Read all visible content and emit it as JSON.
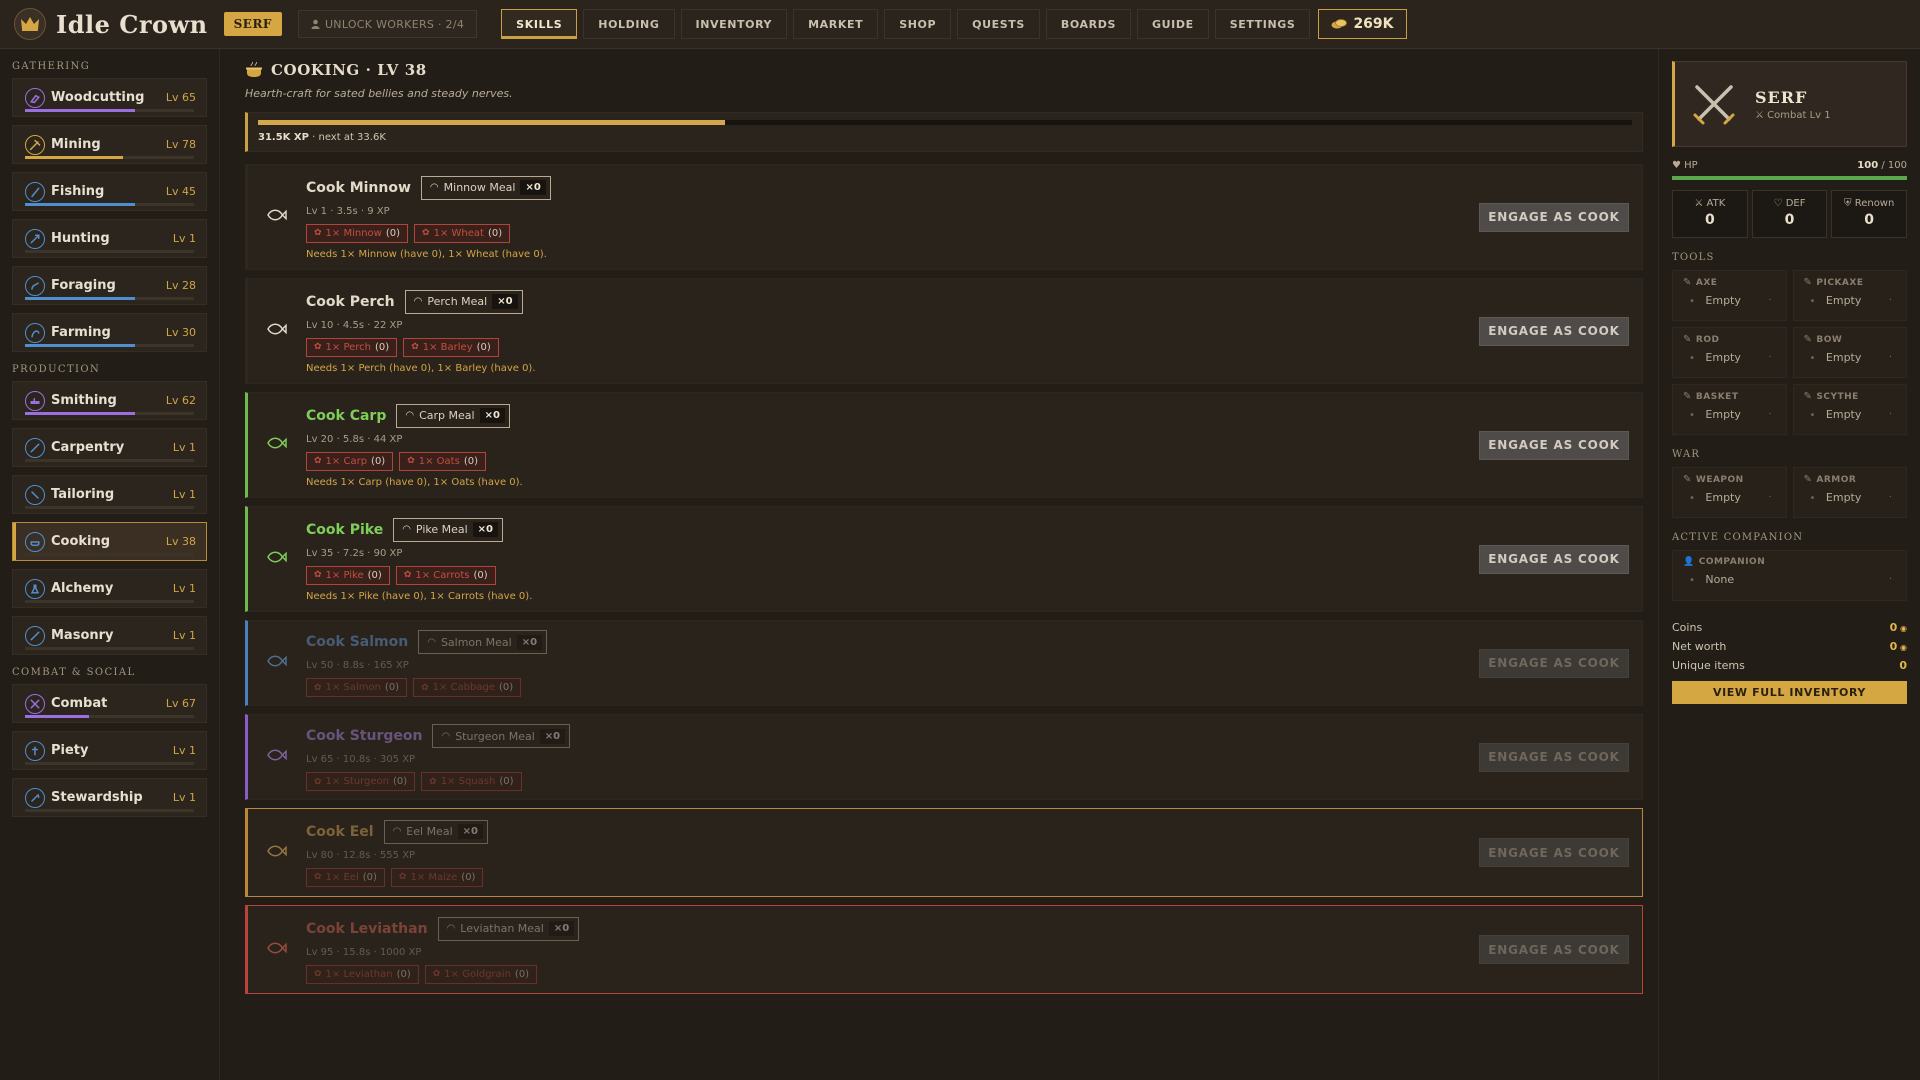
{
  "app": {
    "title": "Idle Crown",
    "rank": "SERF",
    "unlock_workers": "UNLOCK WORKERS · 2/4",
    "coins": "269K"
  },
  "nav": [
    "SKILLS",
    "HOLDING",
    "INVENTORY",
    "MARKET",
    "SHOP",
    "QUESTS",
    "BOARDS",
    "GUIDE",
    "SETTINGS"
  ],
  "sidebar": {
    "groups": [
      {
        "title": "GATHERING",
        "items": [
          {
            "label": "Woodcutting",
            "level": "Lv 65",
            "progress": 0.65,
            "color": "#9b6fe0"
          },
          {
            "label": "Mining",
            "level": "Lv 78",
            "progress": 0.58,
            "color": "#d4a743"
          },
          {
            "label": "Fishing",
            "level": "Lv 45",
            "progress": 0.65,
            "color": "#4f8fd0"
          },
          {
            "label": "Hunting",
            "level": "Lv 1",
            "progress": 0.0,
            "color": "#4f8fd0"
          },
          {
            "label": "Foraging",
            "level": "Lv 28",
            "progress": 0.65,
            "color": "#4f8fd0"
          },
          {
            "label": "Farming",
            "level": "Lv 30",
            "progress": 0.65,
            "color": "#4f8fd0"
          }
        ]
      },
      {
        "title": "PRODUCTION",
        "items": [
          {
            "label": "Smithing",
            "level": "Lv 62",
            "progress": 0.65,
            "color": "#9b6fe0"
          },
          {
            "label": "Carpentry",
            "level": "Lv 1",
            "progress": 0.0,
            "color": "#4f8fd0"
          },
          {
            "label": "Tailoring",
            "level": "Lv 1",
            "progress": 0.0,
            "color": "#4f8fd0"
          },
          {
            "label": "Cooking",
            "level": "Lv 38",
            "progress": 0.0,
            "color": "#4f8fd0"
          },
          {
            "label": "Alchemy",
            "level": "Lv 1",
            "progress": 0.0,
            "color": "#4f8fd0"
          },
          {
            "label": "Masonry",
            "level": "Lv 1",
            "progress": 0.0,
            "color": "#4f8fd0"
          }
        ]
      },
      {
        "title": "COMBAT & SOCIAL",
        "items": [
          {
            "label": "Combat",
            "level": "Lv 67",
            "progress": 0.38,
            "color": "#9b6fe0"
          },
          {
            "label": "Piety",
            "level": "Lv 1",
            "progress": 0.0,
            "color": "#4f8fd0"
          },
          {
            "label": "Stewardship",
            "level": "Lv 1",
            "progress": 0.0,
            "color": "#4f8fd0"
          }
        ]
      }
    ]
  },
  "main": {
    "title": "COOKING · LV 38",
    "subtitle": "Hearth-craft for sated bellies and steady nerves.",
    "xp_current": "31.5K XP",
    "xp_next": " · next at 33.6K",
    "xp_progress": 0.34,
    "engage_label": "ENGAGE AS COOK",
    "recipes": [
      {
        "name": "Cook Minnow",
        "product": "Minnow Meal",
        "count": "×0",
        "meta": "Lv 1 · 3.5s · 9 XP",
        "chips": [
          {
            "label": "1× Minnow",
            "have": "(0)"
          },
          {
            "label": "1× Wheat",
            "have": "(0)"
          }
        ],
        "need": "Needs 1× Minnow (have 0), 1× Wheat (have 0).",
        "accent": "#2e271f",
        "title_color": "#e3d9c8",
        "locked": false
      },
      {
        "name": "Cook Perch",
        "product": "Perch Meal",
        "count": "×0",
        "meta": "Lv 10 · 4.5s · 22 XP",
        "chips": [
          {
            "label": "1× Perch",
            "have": "(0)"
          },
          {
            "label": "1× Barley",
            "have": "(0)"
          }
        ],
        "need": "Needs 1× Perch (have 0), 1× Barley (have 0).",
        "accent": "#2e271f",
        "title_color": "#e3d9c8",
        "locked": false
      },
      {
        "name": "Cook Carp",
        "product": "Carp Meal",
        "count": "×0",
        "meta": "Lv 20 · 5.8s · 44 XP",
        "chips": [
          {
            "label": "1× Carp",
            "have": "(0)"
          },
          {
            "label": "1× Oats",
            "have": "(0)"
          }
        ],
        "need": "Needs 1× Carp (have 0), 1× Oats (have 0).",
        "accent": "#6dbb4c",
        "title_color": "#7fce5a",
        "locked": false
      },
      {
        "name": "Cook Pike",
        "product": "Pike Meal",
        "count": "×0",
        "meta": "Lv 35 · 7.2s · 90 XP",
        "chips": [
          {
            "label": "1× Pike",
            "have": "(0)"
          },
          {
            "label": "1× Carrots",
            "have": "(0)"
          }
        ],
        "need": "Needs 1× Pike (have 0), 1× Carrots (have 0).",
        "accent": "#6dbb4c",
        "title_color": "#7fce5a",
        "locked": false
      },
      {
        "name": "Cook Salmon",
        "product": "Salmon Meal",
        "count": "×0",
        "meta": "Lv 50 · 8.8s · 165 XP",
        "chips": [
          {
            "label": "1× Salmon",
            "have": "(0)"
          },
          {
            "label": "1× Cabbage",
            "have": "(0)"
          }
        ],
        "need": "",
        "accent": "#4a7fc0",
        "title_color": "#6c9fe0",
        "locked": true
      },
      {
        "name": "Cook Sturgeon",
        "product": "Sturgeon Meal",
        "count": "×0",
        "meta": "Lv 65 · 10.8s · 305 XP",
        "chips": [
          {
            "label": "1× Sturgeon",
            "have": "(0)"
          },
          {
            "label": "1× Squash",
            "have": "(0)"
          }
        ],
        "need": "",
        "accent": "#8a5cc8",
        "title_color": "#b58ef0",
        "locked": true
      },
      {
        "name": "Cook Eel",
        "product": "Eel Meal",
        "count": "×0",
        "meta": "Lv 80 · 12.8s · 555 XP",
        "chips": [
          {
            "label": "1× Eel",
            "have": "(0)"
          },
          {
            "label": "1× Maize",
            "have": "(0)"
          }
        ],
        "need": "",
        "accent": "#b8893a",
        "title_color": "#e0b05a",
        "locked": true
      },
      {
        "name": "Cook Leviathan",
        "product": "Leviathan Meal",
        "count": "×0",
        "meta": "Lv 95 · 15.8s · 1000 XP",
        "chips": [
          {
            "label": "1× Leviathan",
            "have": "(0)"
          },
          {
            "label": "1× Goldgrain",
            "have": "(0)"
          }
        ],
        "need": "",
        "accent": "#b8433a",
        "title_color": "#e06a55",
        "locked": true
      }
    ]
  },
  "right": {
    "name": "SERF",
    "combat": "Combat Lv 1",
    "hp_label": "HP",
    "hp_value": "100",
    "hp_max": " / 100",
    "hp_progress": 1.0,
    "stats": [
      {
        "label": "ATK",
        "value": "0"
      },
      {
        "label": "DEF",
        "value": "0"
      },
      {
        "label": "Renown",
        "value": "0"
      }
    ],
    "tools_title": "TOOLS",
    "tools": [
      {
        "label": "AXE",
        "value": "Empty"
      },
      {
        "label": "PICKAXE",
        "value": "Empty"
      },
      {
        "label": "ROD",
        "value": "Empty"
      },
      {
        "label": "BOW",
        "value": "Empty"
      },
      {
        "label": "BASKET",
        "value": "Empty"
      },
      {
        "label": "SCYTHE",
        "value": "Empty"
      }
    ],
    "war_title": "WAR",
    "war": [
      {
        "label": "WEAPON",
        "value": "Empty"
      },
      {
        "label": "ARMOR",
        "value": "Empty"
      }
    ],
    "companion_title": "ACTIVE COMPANION",
    "companion": {
      "label": "COMPANION",
      "value": "None"
    },
    "money": [
      {
        "label": "Coins",
        "value": "0"
      },
      {
        "label": "Net worth",
        "value": "0"
      },
      {
        "label": "Unique items",
        "value": "0"
      }
    ],
    "inventory_button": "VIEW FULL INVENTORY"
  }
}
